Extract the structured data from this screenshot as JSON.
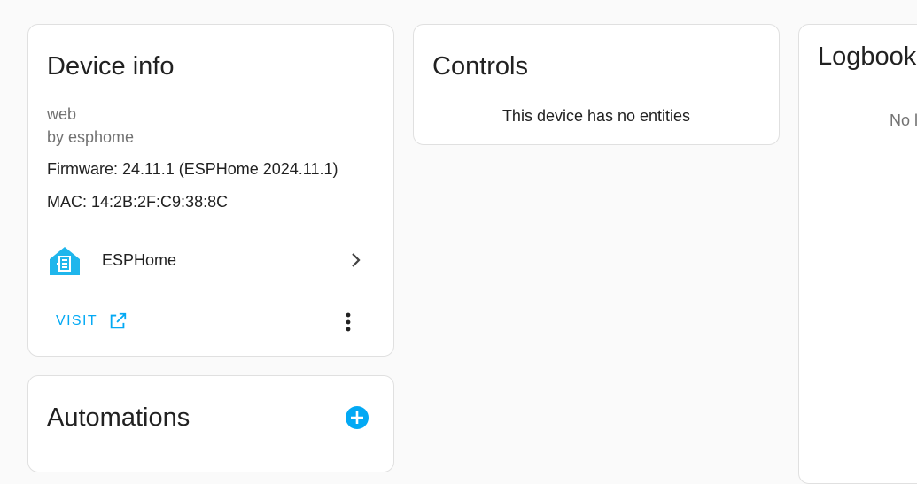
{
  "device_info": {
    "title": "Device info",
    "model": "web",
    "manufacturer": "by esphome",
    "firmware": "Firmware: 24.11.1 (ESPHome 2024.11.1)",
    "mac": "MAC: 14:2B:2F:C9:38:8C",
    "integration": {
      "name": "ESPHome",
      "icon": "esphome-logo-icon"
    },
    "visit_label": "VISIT",
    "visit_icon": "open-in-new-icon",
    "more_icon": "dots-vertical-icon"
  },
  "controls": {
    "title": "Controls",
    "empty_message": "This device has no entities"
  },
  "automations": {
    "title": "Automations",
    "add_icon": "plus-circle-icon"
  },
  "logbook": {
    "title": "Logbook",
    "empty_message": "No l"
  },
  "colors": {
    "accent": "#03a9f4",
    "background": "#fafafa",
    "card": "#ffffff",
    "secondary_text": "#727272",
    "primary_text": "#212121"
  }
}
